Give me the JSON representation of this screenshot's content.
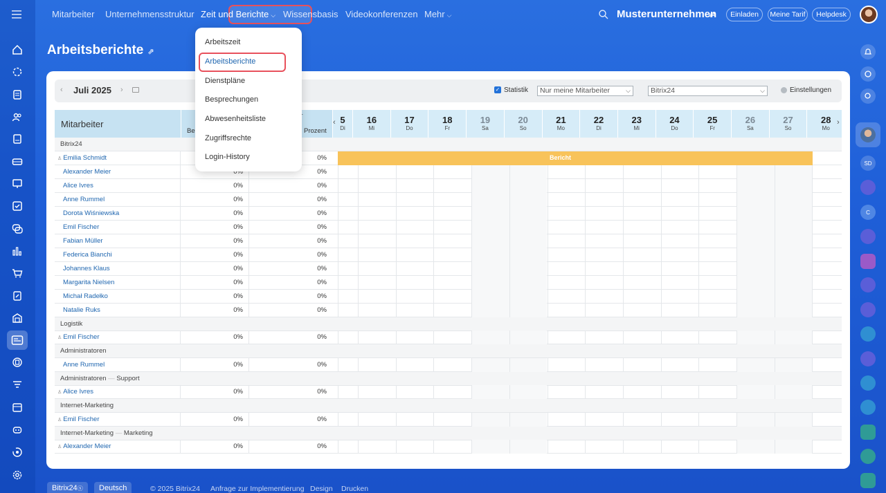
{
  "nav": {
    "items": [
      "Mitarbeiter",
      "Unternehmensstruktur",
      "Zeit und Berichte",
      "Wissensbasis",
      "Videokonferenzen",
      "Mehr"
    ],
    "company": "Musterunternehmen",
    "invite": "Einladen",
    "tariff": "Meine Tarif",
    "helpdesk": "Helpdesk"
  },
  "page": {
    "title": "Arbeitsberichte"
  },
  "toolbar": {
    "month": "Juli 2025",
    "statistik_label": "Statistik",
    "filter_value": "Nur meine Mitarbeiter",
    "dept_value": "Bitrix24",
    "settings_label": "Einstellungen"
  },
  "dropdown": {
    "items": [
      "Arbeitszeit",
      "Arbeitsberichte",
      "Dienstpläne",
      "Besprechungen",
      "Abwesenheitsliste",
      "Zugriffsrechte",
      "Login-History"
    ],
    "selected": "Arbeitsberichte"
  },
  "table": {
    "col_employee": "Mitarbeiter",
    "col_p1_partial": "Be",
    "col_p2_top": "er",
    "col_p2_mid": "n",
    "col_p2_bottom": "Prozent",
    "days": [
      {
        "n": "5",
        "d": "Di"
      },
      {
        "n": "16",
        "d": "Mi"
      },
      {
        "n": "17",
        "d": "Do"
      },
      {
        "n": "18",
        "d": "Fr"
      },
      {
        "n": "19",
        "d": "Sa"
      },
      {
        "n": "20",
        "d": "So"
      },
      {
        "n": "21",
        "d": "Mo"
      },
      {
        "n": "22",
        "d": "Di"
      },
      {
        "n": "23",
        "d": "Mi"
      },
      {
        "n": "24",
        "d": "Do"
      },
      {
        "n": "25",
        "d": "Fr"
      },
      {
        "n": "26",
        "d": "Sa"
      },
      {
        "n": "27",
        "d": "So"
      },
      {
        "n": "28",
        "d": "Mo"
      }
    ],
    "report_label": "Bericht",
    "rows": [
      {
        "type": "group",
        "label": "Bitrix24"
      },
      {
        "type": "emp",
        "name": "Emilia Schmidt",
        "p1": "",
        "p2": "0%",
        "head": true,
        "report": true
      },
      {
        "type": "emp",
        "name": "Alexander Meier",
        "p1": "0%",
        "p2": "0%"
      },
      {
        "type": "emp",
        "name": "Alice Ivres",
        "p1": "0%",
        "p2": "0%"
      },
      {
        "type": "emp",
        "name": "Anne Rummel",
        "p1": "0%",
        "p2": "0%"
      },
      {
        "type": "emp",
        "name": "Dorota Wiśniewska",
        "p1": "0%",
        "p2": "0%"
      },
      {
        "type": "emp",
        "name": "Emil Fischer",
        "p1": "0%",
        "p2": "0%"
      },
      {
        "type": "emp",
        "name": "Fabian Müller",
        "p1": "0%",
        "p2": "0%"
      },
      {
        "type": "emp",
        "name": "Federica Bianchi",
        "p1": "0%",
        "p2": "0%"
      },
      {
        "type": "emp",
        "name": "Johannes Klaus",
        "p1": "0%",
        "p2": "0%"
      },
      {
        "type": "emp",
        "name": "Margarita Nielsen",
        "p1": "0%",
        "p2": "0%"
      },
      {
        "type": "emp",
        "name": "Michał Radełko",
        "p1": "0%",
        "p2": "0%"
      },
      {
        "type": "emp",
        "name": "Natalie Ruks",
        "p1": "0%",
        "p2": "0%"
      },
      {
        "type": "group",
        "label": "Logistik"
      },
      {
        "type": "emp",
        "name": "Emil Fischer",
        "p1": "0%",
        "p2": "0%",
        "head": true
      },
      {
        "type": "group",
        "label": "Administratoren"
      },
      {
        "type": "emp",
        "name": "Anne Rummel",
        "p1": "0%",
        "p2": "0%"
      },
      {
        "type": "group",
        "label": "Administratoren",
        "sub": "Support"
      },
      {
        "type": "emp",
        "name": "Alice Ivres",
        "p1": "0%",
        "p2": "0%",
        "head": true
      },
      {
        "type": "group",
        "label": "Internet-Marketing"
      },
      {
        "type": "emp",
        "name": "Emil Fischer",
        "p1": "0%",
        "p2": "0%",
        "head": true
      },
      {
        "type": "group",
        "label": "Internet-Marketing",
        "sub": "Marketing"
      },
      {
        "type": "emp",
        "name": "Alexander Meier",
        "p1": "0%",
        "p2": "0%",
        "head": true
      }
    ]
  },
  "footer": {
    "brand": "Bitrix24",
    "lang": "Deutsch",
    "copyright": "© 2025 Bitrix24",
    "links": [
      "Anfrage zur Implementierung",
      "Design",
      "Drucken"
    ]
  },
  "right_avatar_initials": [
    "SD",
    "C"
  ]
}
